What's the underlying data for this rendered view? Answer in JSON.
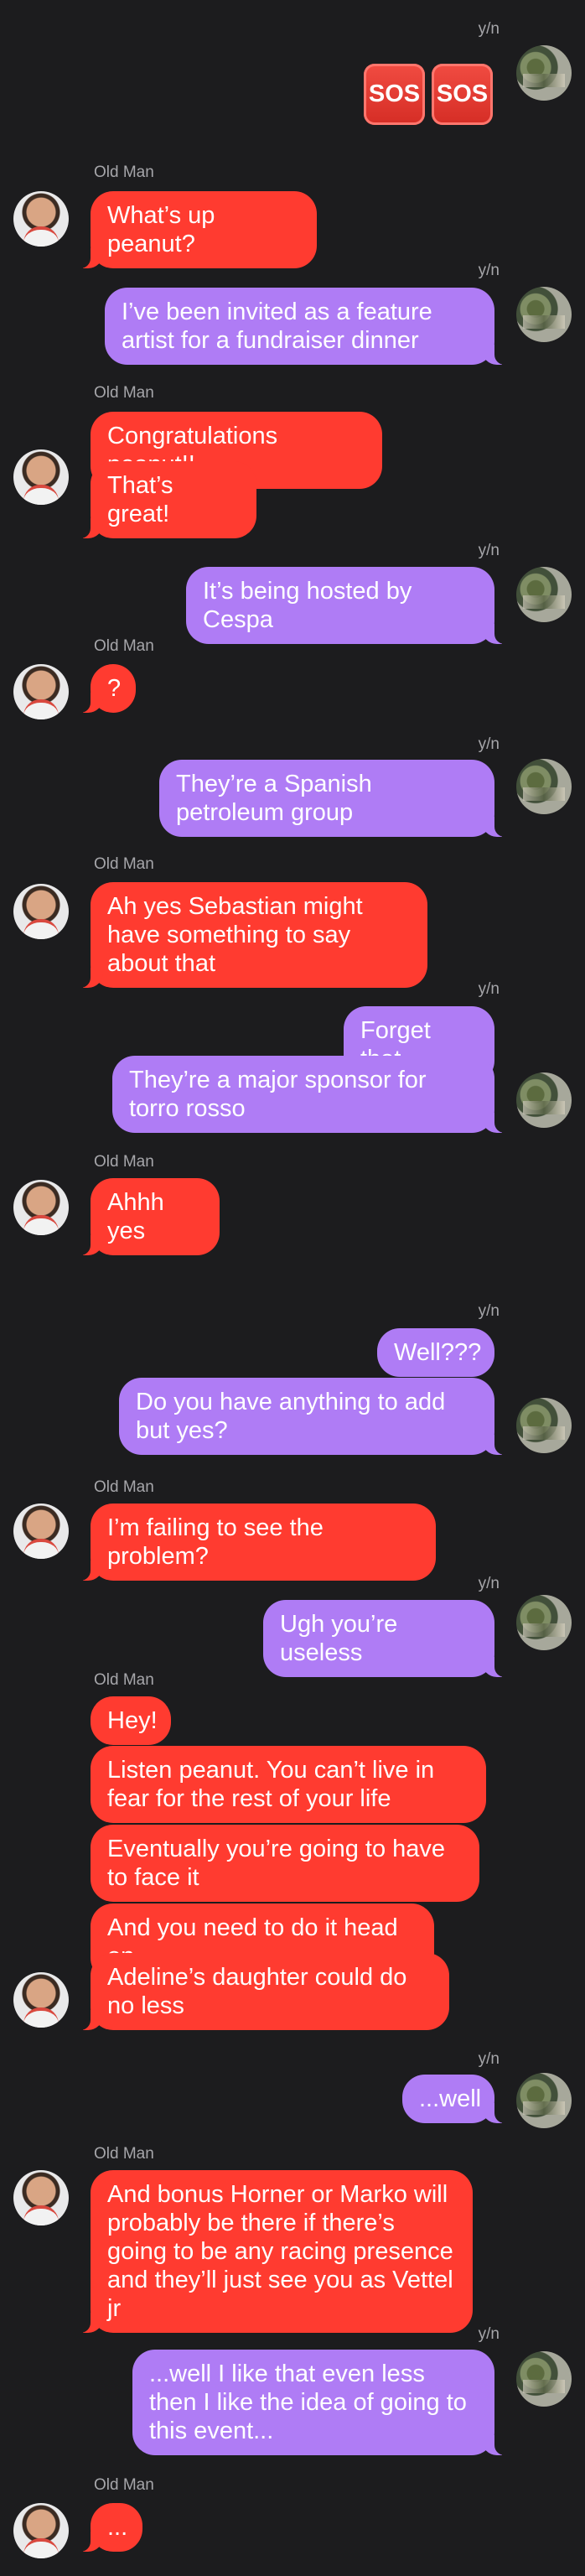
{
  "names": {
    "me": "y/n",
    "them": "Old Man"
  },
  "sos": [
    "SOS",
    "SOS"
  ],
  "messages": [
    {
      "text": "What’s up peanut?"
    },
    {
      "text": "I’ve been invited as a feature artist for a fundraiser dinner"
    },
    {
      "text": "Congratulations peanut!!"
    },
    {
      "text": "That’s great!"
    },
    {
      "text": "It’s being hosted by Cespa"
    },
    {
      "text": "?"
    },
    {
      "text": "They’re a Spanish petroleum group"
    },
    {
      "text": "Ah yes Sebastian might have something to say about that"
    },
    {
      "text": "Forget that"
    },
    {
      "text": "They’re a major sponsor for torro rosso"
    },
    {
      "text": "Ahhh yes"
    },
    {
      "text": "Well???"
    },
    {
      "text": "Do you have anything to add but yes?"
    },
    {
      "text": "I’m failing to see the problem?"
    },
    {
      "text": "Ugh you’re useless"
    },
    {
      "text": "Hey!"
    },
    {
      "text": "Listen peanut. You can’t live in fear for the rest of your life"
    },
    {
      "text": "Eventually you’re going to have to face it"
    },
    {
      "text": "And you need to do it head on"
    },
    {
      "text": "Adeline’s daughter could do no less"
    },
    {
      "text": "...well"
    },
    {
      "text": "And bonus Horner or Marko will probably be there if there’s going to be any racing presence and they’ll just see you as Vettel jr"
    },
    {
      "text": "...well I like that even less then I like the idea of going to this event..."
    },
    {
      "text": "..."
    }
  ]
}
